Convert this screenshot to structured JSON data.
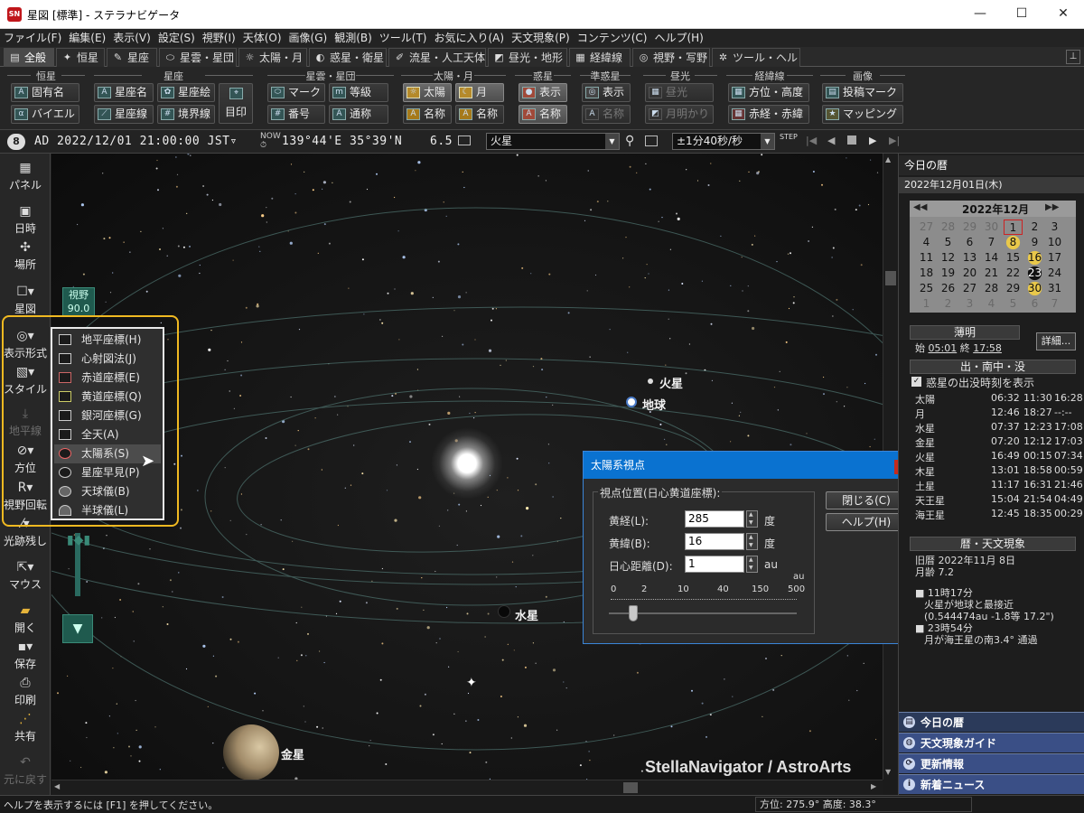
{
  "app": {
    "title": "星図 [標準] - ステラナビゲータ",
    "window_buttons": [
      "—",
      "☐",
      "✕"
    ]
  },
  "menu": [
    "ファイル(F)",
    "編集(E)",
    "表示(V)",
    "設定(S)",
    "視野(I)",
    "天体(O)",
    "画像(G)",
    "観測(B)",
    "ツール(T)",
    "お気に入り(A)",
    "天文現象(P)",
    "コンテンツ(C)",
    "ヘルプ(H)"
  ],
  "tabs": [
    {
      "label": "全般",
      "icon": "▤",
      "active": true
    },
    {
      "label": "恒星",
      "icon": "✦"
    },
    {
      "label": "星座",
      "icon": "✎"
    },
    {
      "label": "星雲・星団",
      "icon": "⬭"
    },
    {
      "label": "太陽・月",
      "icon": "☼"
    },
    {
      "label": "惑星・衛星",
      "icon": "◐"
    },
    {
      "label": "流星・人工天体",
      "icon": "✐"
    },
    {
      "label": "昼光・地形",
      "icon": "◩"
    },
    {
      "label": "経緯線",
      "icon": "▦"
    },
    {
      "label": "視野・写野",
      "icon": "◎"
    },
    {
      "label": "ツール・ヘルプ",
      "icon": "✲"
    }
  ],
  "ribbon": {
    "groups": [
      "恒星",
      "星座",
      "星雲・星団",
      "太陽・月",
      "惑星",
      "準惑星",
      "昼光",
      "経緯線",
      "画像"
    ],
    "buttons": {
      "proper_name": "固有名",
      "bayer": "バイエル",
      "const_name": "星座名",
      "const_art": "星座絵",
      "const_line": "星座線",
      "boundary": "境界線",
      "guide": "目印",
      "mark": "マーク",
      "magnitude": "等級",
      "number": "番号",
      "common_name": "通称",
      "sun": "太陽",
      "moon": "月",
      "sm_name1": "名称",
      "sm_name2": "名称",
      "planet_show": "表示",
      "planet_name": "名称",
      "dwarf_show": "表示",
      "dwarf_name": "名称",
      "daylight": "昼光",
      "moonlight": "月明かり",
      "altaz": "方位・高度",
      "radec": "赤経・赤緯",
      "post_mark": "投稿マーク",
      "mapping": "マッピング"
    }
  },
  "toolbar": {
    "datetime": "AD 2022/12/01 21:00:00 JST▿",
    "coords": "139°44'E 35°39'N",
    "magnitude": "6.5",
    "target": "火星",
    "step": "±1分40秒/秒",
    "step_label": "STEP"
  },
  "leftbar": {
    "panel": "パネル",
    "datetime": "日時",
    "place": "場所",
    "starmap": "星図",
    "display_format": "表示形式",
    "style": "スタイル",
    "horizon": "地平線",
    "direction": "方位",
    "rotation": "視野回転",
    "trail": "光跡残し",
    "mouse": "マウス",
    "open": "開く",
    "save": "保存",
    "print": "印刷",
    "share": "共有",
    "undo": "元に戻す"
  },
  "fov": {
    "label": "視野",
    "value": "90.0"
  },
  "display_menu": [
    {
      "label": "地平座標(H)"
    },
    {
      "label": "心射図法(J)"
    },
    {
      "label": "赤道座標(E)"
    },
    {
      "label": "黄道座標(Q)"
    },
    {
      "label": "銀河座標(G)"
    },
    {
      "label": "全天(A)"
    },
    {
      "label": "太陽系(S)",
      "highlighted": true
    },
    {
      "label": "星座早見(P)"
    },
    {
      "label": "天球儀(B)"
    },
    {
      "label": "半球儀(L)"
    }
  ],
  "sky": {
    "labels": {
      "mars": "火星",
      "earth": "地球",
      "mercury": "水星",
      "venus": "金星"
    },
    "watermark": "StellaNavigator / AstroArts"
  },
  "dialog": {
    "title": "太陽系視点",
    "close": "x",
    "group_label": "視点位置(日心黄道座標):",
    "close_btn": "閉じる(C)",
    "help_btn": "ヘルプ(H)",
    "longitude_label": "黄経(L):",
    "longitude_value": "285",
    "longitude_unit": "度",
    "latitude_label": "黄緯(B):",
    "latitude_value": "16",
    "latitude_unit": "度",
    "distance_label": "日心距離(D):",
    "distance_value": "1",
    "distance_unit": "au",
    "scale_unit": "au",
    "scale_ticks": [
      "0",
      "2",
      "10",
      "40",
      "150",
      "500"
    ]
  },
  "right": {
    "header": "今日の暦",
    "date": "2022年12月01日(木)",
    "cal_title": "2022年12月",
    "cal_nav_prev": "◀◀",
    "cal_nav_next": "▶▶",
    "cal_rows": [
      [
        "27",
        "28",
        "29",
        "30",
        "1",
        "2",
        "3"
      ],
      [
        "4",
        "5",
        "6",
        "7",
        "8",
        "9",
        "10"
      ],
      [
        "11",
        "12",
        "13",
        "14",
        "15",
        "16",
        "17"
      ],
      [
        "18",
        "19",
        "20",
        "21",
        "22",
        "23",
        "24"
      ],
      [
        "25",
        "26",
        "27",
        "28",
        "29",
        "30",
        "31"
      ],
      [
        "1",
        "2",
        "3",
        "4",
        "5",
        "6",
        "7"
      ]
    ],
    "twilight": "薄明",
    "twi_start_label": "始",
    "twi_start": "05:01",
    "twi_end_label": "終",
    "twi_end": "17:58",
    "detail_btn": "詳細...",
    "rise_set": "出・南中・没",
    "show_planets_label": "惑星の出没時刻を表示",
    "bodies": [
      [
        "太陽",
        "06:32",
        "11:30",
        "16:28"
      ],
      [
        "月",
        "12:46",
        "18:27",
        "--:--"
      ],
      [
        "水星",
        "07:37",
        "12:23",
        "17:08"
      ],
      [
        "金星",
        "07:20",
        "12:12",
        "17:03"
      ],
      [
        "火星",
        "16:49",
        "00:15",
        "07:34"
      ],
      [
        "木星",
        "13:01",
        "18:58",
        "00:59"
      ],
      [
        "土星",
        "11:17",
        "16:31",
        "21:46"
      ],
      [
        "天王星",
        "15:04",
        "21:54",
        "04:49"
      ],
      [
        "海王星",
        "12:45",
        "18:35",
        "00:29"
      ]
    ],
    "calendar_events": "暦・天文現象",
    "lunar1": "旧暦 2022年11月 8日",
    "lunar2": "月齢 7.2",
    "ev1_time": "11時17分",
    "ev1_text1": "火星が地球と最接近",
    "ev1_text2": "(0.544474au -1.8等 17.2\")",
    "ev2_time": "23時54分",
    "ev2_text": "月が海王星の南3.4° 通過",
    "bottom": [
      "今日の暦",
      "天文現象ガイド",
      "更新情報",
      "新着ニュース"
    ]
  },
  "status": {
    "help": "ヘルプを表示するには [F1] を押してください。",
    "coords": "方位: 275.9° 高度: 38.3°"
  }
}
